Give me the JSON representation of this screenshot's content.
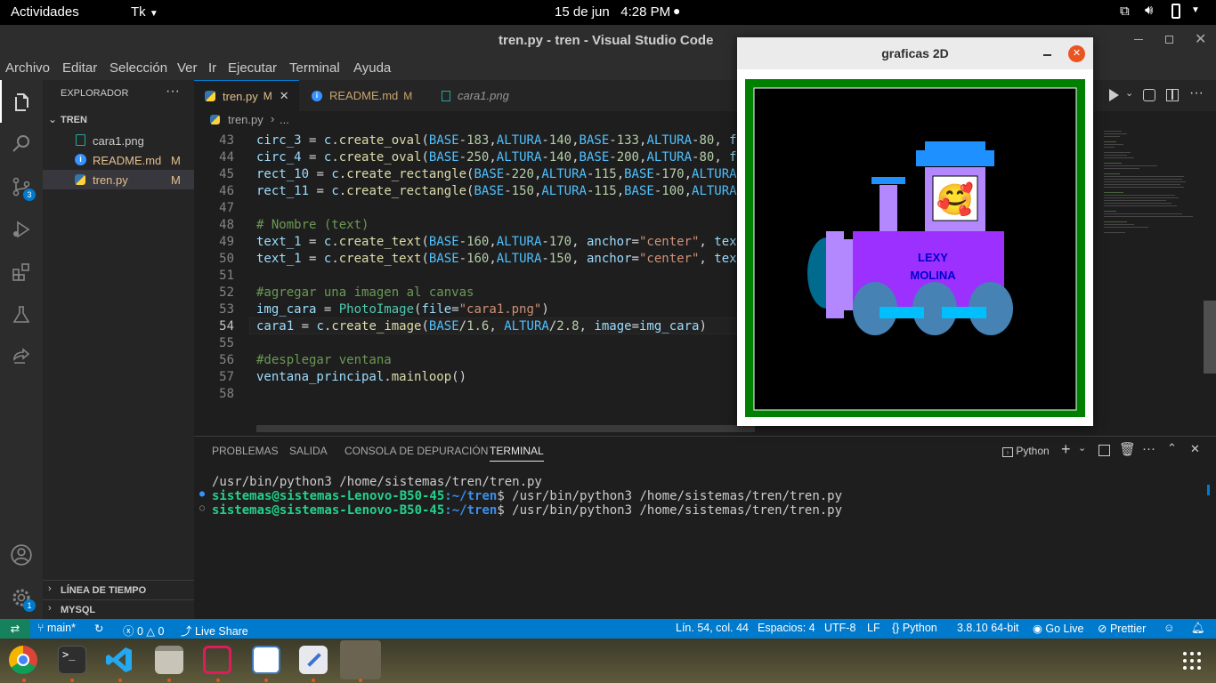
{
  "topbar": {
    "activities": "Actividades",
    "app_menu": "Tk",
    "date": "15 de jun",
    "time": "4:28 PM"
  },
  "vscode": {
    "window_title": "tren.py - tren - Visual Studio Code",
    "menu": [
      "Archivo",
      "Editar",
      "Selección",
      "Ver",
      "Ir",
      "Ejecutar",
      "Terminal",
      "Ayuda"
    ],
    "explorer": {
      "title": "EXPLORADOR",
      "folder": "TREN",
      "files": [
        {
          "name": "cara1.png",
          "badge": ""
        },
        {
          "name": "README.md",
          "badge": "M"
        },
        {
          "name": "tren.py",
          "badge": "M"
        }
      ],
      "timeline": "LÍNEA DE TIEMPO",
      "mysql": "MYSQL"
    },
    "badges": {
      "source_control": "3",
      "settings": "1"
    },
    "tabs": [
      {
        "label": "tren.py",
        "modified": "M",
        "active": true
      },
      {
        "label": "README.md",
        "modified": "M",
        "active": false
      },
      {
        "label": "cara1.png",
        "modified": "",
        "active": false
      }
    ],
    "breadcrumb": [
      "tren.py",
      "..."
    ],
    "code_lines": [
      {
        "n": "43",
        "text": "circ_3 = c.create_oval(BASE-183,ALTURA-140,BASE-133,ALTURA-80, f"
      },
      {
        "n": "44",
        "text": "circ_4 = c.create_oval(BASE-250,ALTURA-140,BASE-200,ALTURA-80, f"
      },
      {
        "n": "45",
        "text": "rect_10 = c.create_rectangle(BASE-220,ALTURA-115,BASE-170,ALTURA"
      },
      {
        "n": "46",
        "text": "rect_11 = c.create_rectangle(BASE-150,ALTURA-115,BASE-100,ALTURA"
      },
      {
        "n": "47",
        "text": ""
      },
      {
        "n": "48",
        "text": "# Nombre (text)"
      },
      {
        "n": "49",
        "text": "text_1 = c.create_text(BASE-160,ALTURA-170, anchor=\"center\", tex"
      },
      {
        "n": "50",
        "text": "text_1 = c.create_text(BASE-160,ALTURA-150, anchor=\"center\", tex"
      },
      {
        "n": "51",
        "text": ""
      },
      {
        "n": "52",
        "text": "#agregar una imagen al canvas"
      },
      {
        "n": "53",
        "text": "img_cara = PhotoImage(file=\"cara1.png\")"
      },
      {
        "n": "54",
        "text": "cara1 = c.create_image(BASE/1.6, ALTURA/2.8, image=img_cara)"
      },
      {
        "n": "55",
        "text": ""
      },
      {
        "n": "56",
        "text": "#desplegar ventana"
      },
      {
        "n": "57",
        "text": "ventana_principal.mainloop()"
      },
      {
        "n": "58",
        "text": ""
      }
    ],
    "panel_tabs": [
      "PROBLEMAS",
      "SALIDA",
      "CONSOLA DE DEPURACIÓN",
      "TERMINAL"
    ],
    "terminal_profile": "Python",
    "terminal_lines": [
      {
        "prefix": "",
        "prompt": "",
        "path": "",
        "cmd": "/usr/bin/python3 /home/sistemas/tren/tren.py"
      },
      {
        "prefix": "●",
        "prompt": "sistemas@sistemas-Lenovo-B50-45",
        "path": ":~/tren",
        "cmd": "$ /usr/bin/python3 /home/sistemas/tren/tren.py"
      },
      {
        "prefix": "○",
        "prompt": "sistemas@sistemas-Lenovo-B50-45",
        "path": ":~/tren",
        "cmd": "$ /usr/bin/python3 /home/sistemas/tren/tren.py"
      }
    ],
    "status": {
      "branch": "main*",
      "errors": "0",
      "warnings": "0",
      "live_share": "Live Share",
      "position": "Lín. 54, col. 44",
      "spaces": "Espacios: 4",
      "encoding": "UTF-8",
      "eol": "LF",
      "language": "Python",
      "interpreter": "3.8.10 64-bit",
      "go_live": "Go Live",
      "prettier": "Prettier"
    }
  },
  "tk_window": {
    "title": "graficas 2D",
    "name_line1": "LEXY",
    "name_line2": "MOLINA",
    "face_emoji": "🥰"
  },
  "colors": {
    "status_blue": "#007acc",
    "train_purple": "#9b30ff",
    "frame_green": "#008000"
  }
}
